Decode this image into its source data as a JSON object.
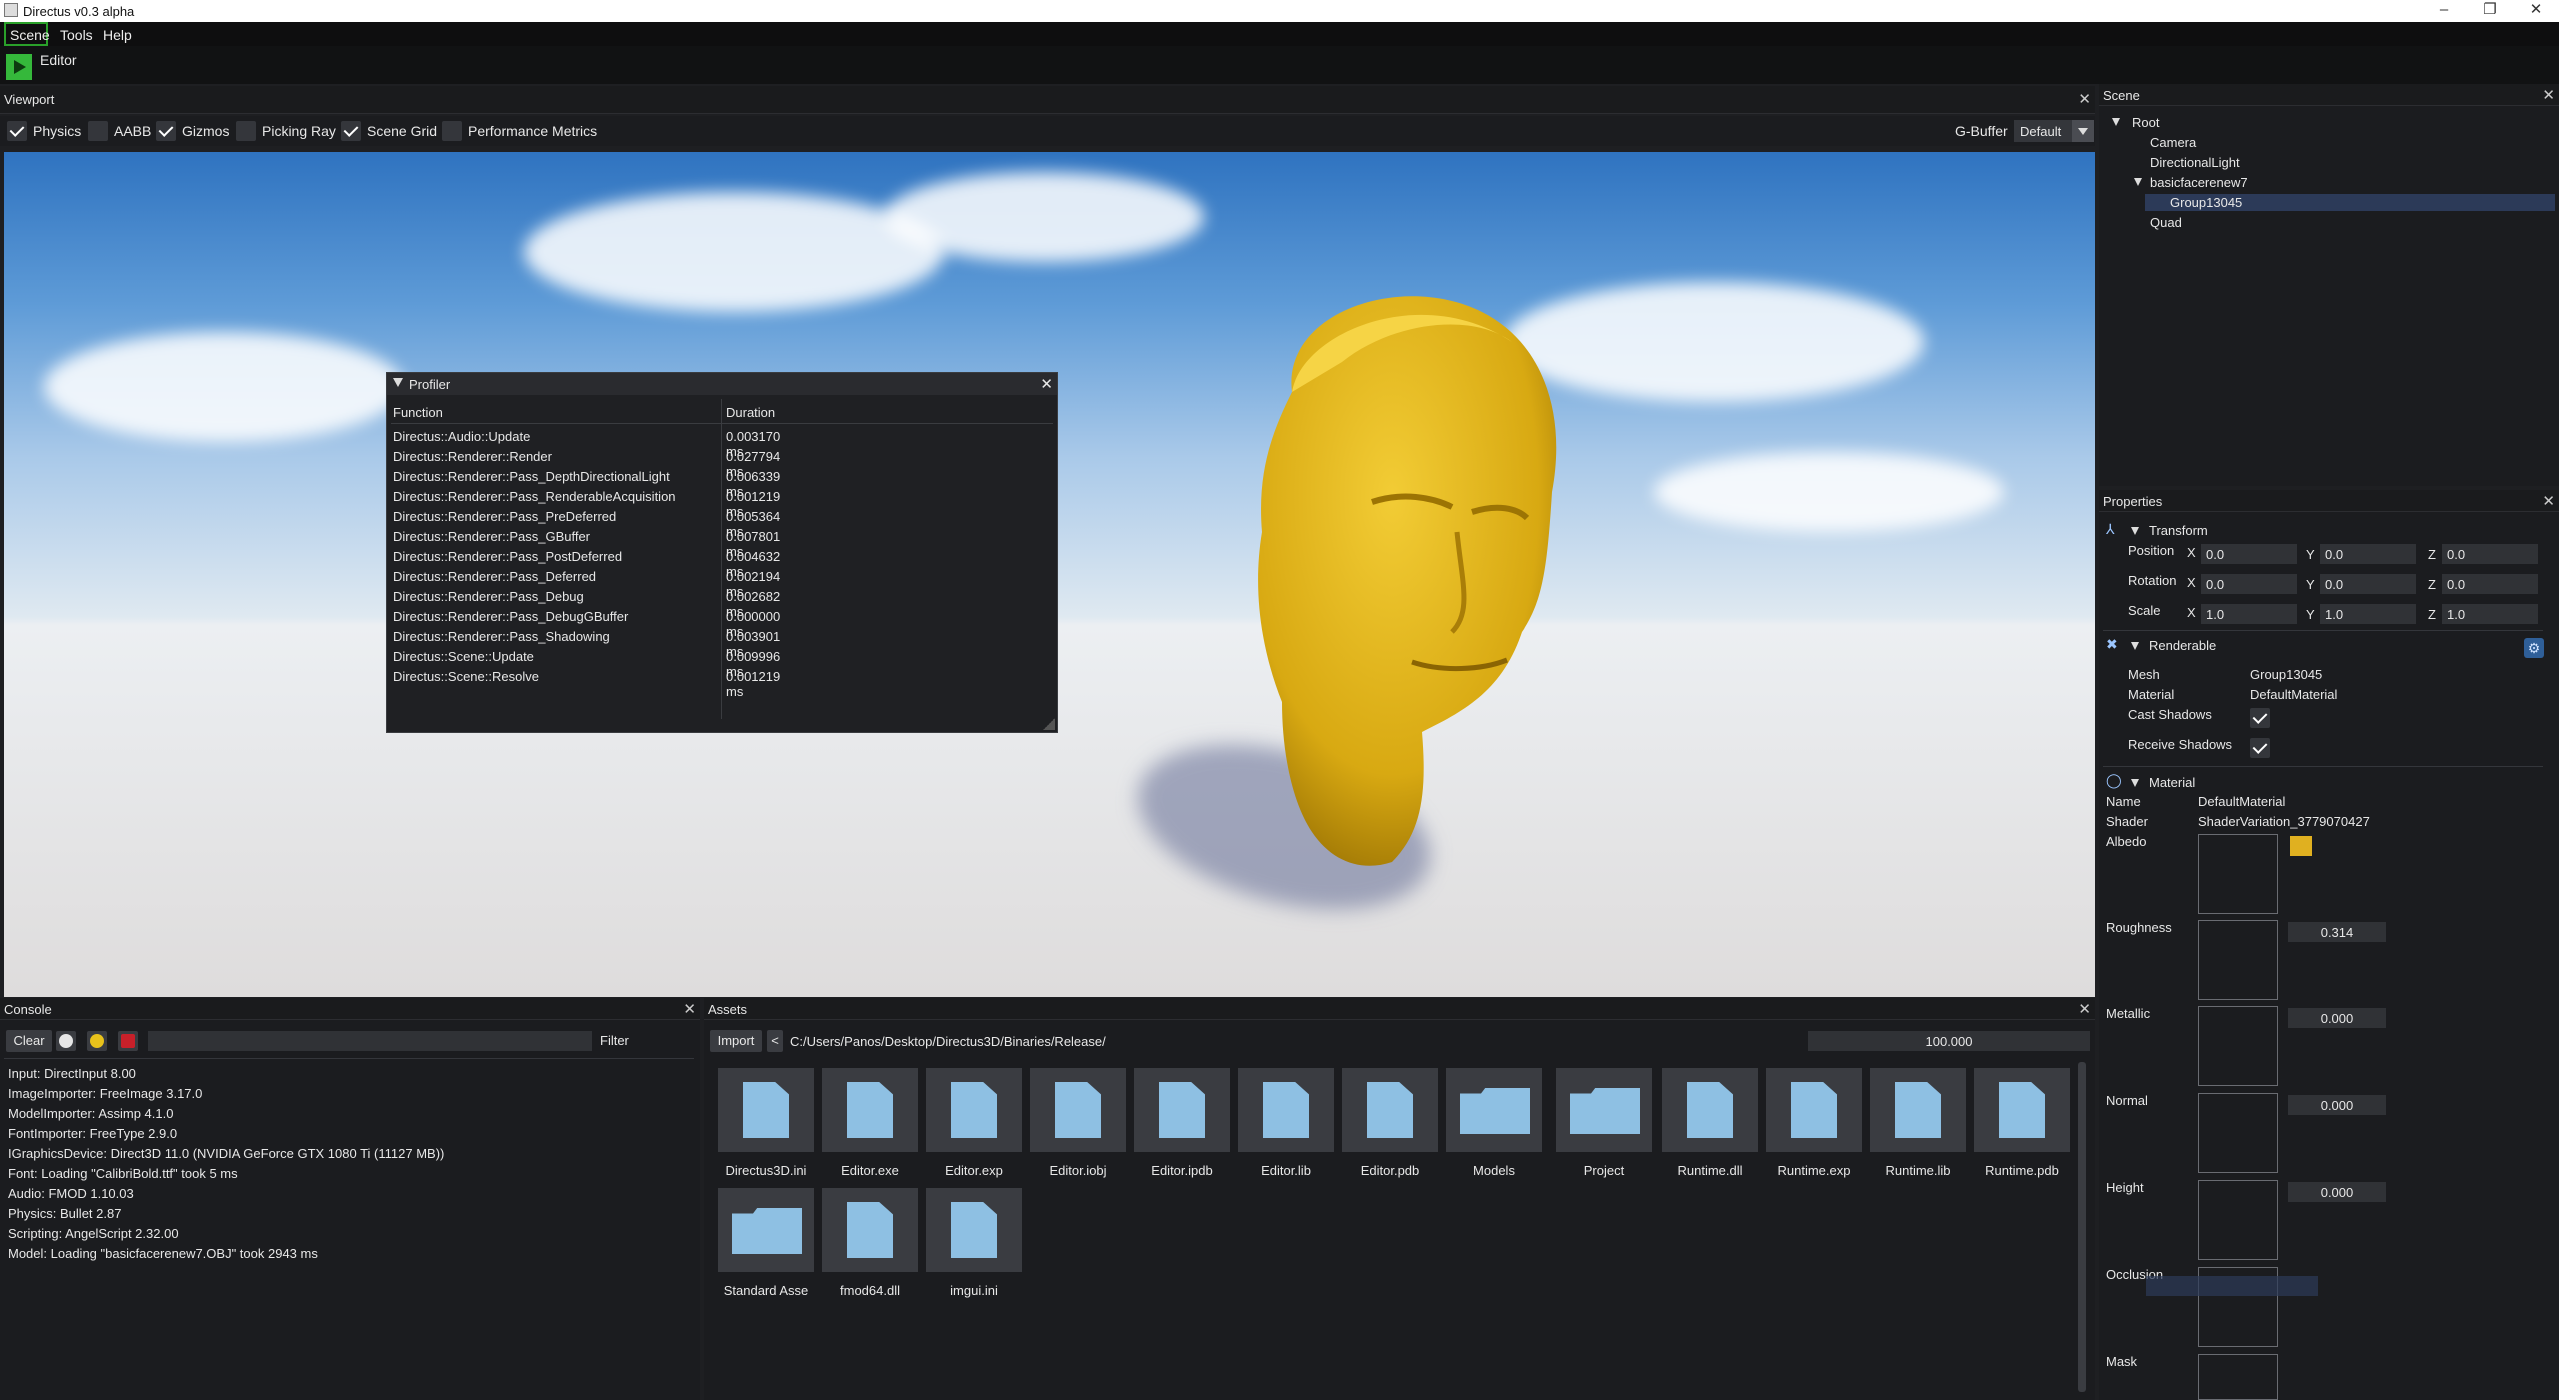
{
  "window": {
    "title": "Directus v0.3 alpha",
    "min": "–",
    "max": "❐",
    "close": "✕"
  },
  "menu": {
    "items": [
      "Scene",
      "Tools",
      "Help"
    ]
  },
  "toolbar": {
    "editor_label": "Editor"
  },
  "viewport": {
    "title": "Viewport",
    "options": [
      {
        "label": "Physics",
        "checked": true
      },
      {
        "label": "AABB",
        "checked": false
      },
      {
        "label": "Gizmos",
        "checked": true
      },
      {
        "label": "Picking Ray",
        "checked": false
      },
      {
        "label": "Scene Grid",
        "checked": true
      },
      {
        "label": "Performance Metrics",
        "checked": false
      }
    ],
    "gbuffer_label": "G-Buffer",
    "gbuffer_value": "Default"
  },
  "profiler": {
    "title": "Profiler",
    "col_function": "Function",
    "col_duration": "Duration",
    "rows": [
      {
        "fn": "Directus::Audio::Update",
        "dur": "0.003170 ms"
      },
      {
        "fn": "Directus::Renderer::Render",
        "dur": "0.027794 ms"
      },
      {
        "fn": "Directus::Renderer::Pass_DepthDirectionalLight",
        "dur": "0.006339 ms"
      },
      {
        "fn": "Directus::Renderer::Pass_RenderableAcquisition",
        "dur": "0.001219 ms"
      },
      {
        "fn": "Directus::Renderer::Pass_PreDeferred",
        "dur": "0.005364 ms"
      },
      {
        "fn": "Directus::Renderer::Pass_GBuffer",
        "dur": "0.007801 ms"
      },
      {
        "fn": "Directus::Renderer::Pass_PostDeferred",
        "dur": "0.004632 ms"
      },
      {
        "fn": "Directus::Renderer::Pass_Deferred",
        "dur": "0.002194 ms"
      },
      {
        "fn": "Directus::Renderer::Pass_Debug",
        "dur": "0.002682 ms"
      },
      {
        "fn": "Directus::Renderer::Pass_DebugGBuffer",
        "dur": "0.000000 ms"
      },
      {
        "fn": "Directus::Renderer::Pass_Shadowing",
        "dur": "0.003901 ms"
      },
      {
        "fn": "Directus::Scene::Update",
        "dur": "0.009996 ms"
      },
      {
        "fn": "Directus::Scene::Resolve",
        "dur": "0.001219 ms"
      }
    ]
  },
  "scene": {
    "title": "Scene",
    "root": "Root",
    "camera": "Camera",
    "light": "DirectionalLight",
    "group_parent": "basicfacerenew7",
    "group_child": "Group13045",
    "quad": "Quad"
  },
  "properties": {
    "title": "Properties",
    "transform": {
      "title": "Transform",
      "position_label": "Position",
      "rotation_label": "Rotation",
      "scale_label": "Scale",
      "x": "X",
      "y": "Y",
      "z": "Z",
      "position": [
        "0.0",
        "0.0",
        "0.0"
      ],
      "rotation": [
        "0.0",
        "0.0",
        "0.0"
      ],
      "scale": [
        "1.0",
        "1.0",
        "1.0"
      ]
    },
    "renderable": {
      "title": "Renderable",
      "mesh_label": "Mesh",
      "mesh": "Group13045",
      "material_label": "Material",
      "material": "DefaultMaterial",
      "cast_label": "Cast Shadows",
      "receive_label": "Receive Shadows",
      "cast": true,
      "receive": true
    },
    "material": {
      "title": "Material",
      "name_label": "Name",
      "name": "DefaultMaterial",
      "shader_label": "Shader",
      "shader": "ShaderVariation_3779070427",
      "albedo_label": "Albedo",
      "albedo_color": "#e0b020",
      "roughness_label": "Roughness",
      "roughness": "0.314",
      "metallic_label": "Metallic",
      "metallic": "0.000",
      "normal_label": "Normal",
      "normal": "0.000",
      "height_label": "Height",
      "height": "0.000",
      "occlusion_label": "Occlusion",
      "mask_label": "Mask"
    }
  },
  "console": {
    "title": "Console",
    "clear": "Clear",
    "filter": "Filter",
    "lines": [
      "Input: DirectInput 8.00",
      "ImageImporter: FreeImage 3.17.0",
      "ModelImporter: Assimp 4.1.0",
      "FontImporter: FreeType 2.9.0",
      "IGraphicsDevice: Direct3D 11.0 (NVIDIA GeForce GTX 1080 Ti (11127 MB))",
      "Font: Loading \"CalibriBold.ttf\" took 5 ms",
      "Audio: FMOD 1.10.03",
      "Physics: Bullet 2.87",
      "Scripting: AngelScript 2.32.00",
      "Model: Loading \"basicfacerenew7.OBJ\" took 2943 ms"
    ]
  },
  "assets": {
    "title": "Assets",
    "import": "Import",
    "back": "<",
    "path": "C:/Users/Panos/Desktop/Directus3D/Binaries/Release/",
    "zoom": "100.000",
    "items": [
      {
        "name": "Directus3D.ini",
        "type": "file"
      },
      {
        "name": "Editor.exe",
        "type": "file"
      },
      {
        "name": "Editor.exp",
        "type": "file"
      },
      {
        "name": "Editor.iobj",
        "type": "file"
      },
      {
        "name": "Editor.ipdb",
        "type": "file"
      },
      {
        "name": "Editor.lib",
        "type": "file"
      },
      {
        "name": "Editor.pdb",
        "type": "file"
      },
      {
        "name": "Models",
        "type": "folder"
      },
      {
        "name": "Project",
        "type": "folder"
      },
      {
        "name": "Runtime.dll",
        "type": "file"
      },
      {
        "name": "Runtime.exp",
        "type": "file"
      },
      {
        "name": "Runtime.lib",
        "type": "file"
      },
      {
        "name": "Runtime.pdb",
        "type": "file"
      },
      {
        "name": "Standard Asse",
        "type": "folder"
      },
      {
        "name": "fmod64.dll",
        "type": "file"
      },
      {
        "name": "imgui.ini",
        "type": "file"
      }
    ]
  }
}
